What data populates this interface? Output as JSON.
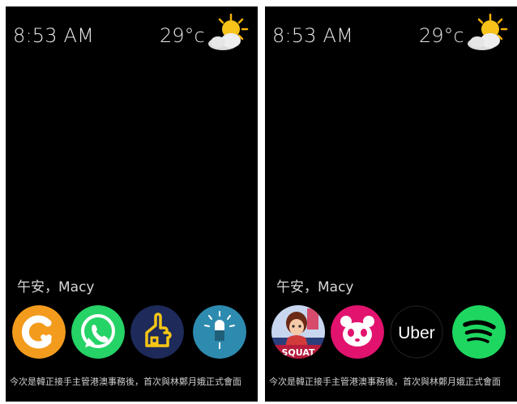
{
  "screens": [
    {
      "status": {
        "time": "8:53 AM",
        "temperature": "29°c",
        "weather_icon": "partly-cloudy-sun-icon"
      },
      "greeting": "午安，Macy",
      "apps": [
        {
          "name": "orange-c-app-icon",
          "color": "#f29b1d"
        },
        {
          "name": "whatsapp-icon",
          "color": "#25d366"
        },
        {
          "name": "yellow-hand-home-app-icon",
          "color": "#1d2a5a"
        },
        {
          "name": "bulb-app-icon",
          "color": "#2e8bb0"
        }
      ],
      "ticker": "今次是韓正接手主管港澳事務後，首次與林鄭月娥正式會面"
    },
    {
      "status": {
        "time": "8:53 AM",
        "temperature": "29°c",
        "weather_icon": "partly-cloudy-sun-icon"
      },
      "greeting": "午安，Macy",
      "apps": [
        {
          "name": "squat-game-app-icon",
          "label": "SQUAT",
          "color": "#b71c3c"
        },
        {
          "name": "foodpanda-icon",
          "color": "#e2136e"
        },
        {
          "name": "uber-icon",
          "label": "Uber",
          "color": "#000000"
        },
        {
          "name": "spotify-icon",
          "color": "#1ed760"
        }
      ],
      "ticker": "今次是韓正接手主管港澳事務後，首次與林鄭月娥正式會面"
    }
  ]
}
